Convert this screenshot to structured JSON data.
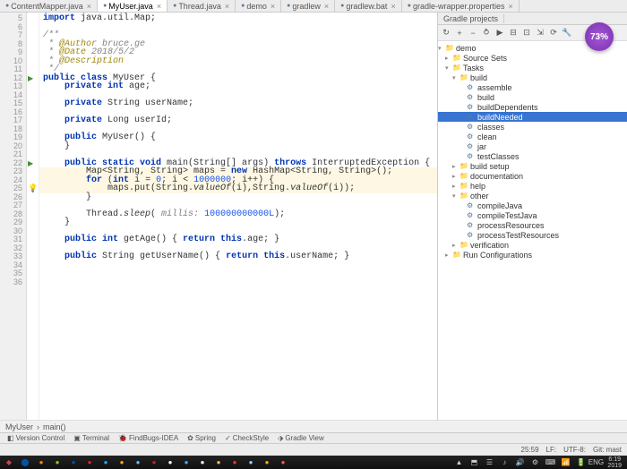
{
  "editor_tabs": [
    {
      "label": "ContentMapper.java",
      "active": false
    },
    {
      "label": "MyUser.java",
      "active": true
    },
    {
      "label": "Thread.java",
      "active": false
    },
    {
      "label": "demo",
      "active": false
    },
    {
      "label": "gradlew",
      "active": false
    },
    {
      "label": "gradlew.bat",
      "active": false
    },
    {
      "label": "gradle-wrapper.properties",
      "active": false
    }
  ],
  "right_tab": "Gradle projects",
  "line_start": 5,
  "line_end": 36,
  "code_lines": [
    {
      "n": 5,
      "html": "<span class='kw'>import</span> java.util.Map;"
    },
    {
      "n": 6,
      "html": ""
    },
    {
      "n": 7,
      "html": "<span class='cm'>/**</span>"
    },
    {
      "n": 8,
      "html": "<span class='cm'> * <span class='ann'>@Author</span> bruce.ge</span>"
    },
    {
      "n": 9,
      "html": "<span class='cm'> * <span class='ann'>@Date</span> 2018/5/2</span>"
    },
    {
      "n": 10,
      "html": "<span class='cm'> * <span class='ann'>@Description</span></span>"
    },
    {
      "n": 11,
      "html": "<span class='cm'> */</span>"
    },
    {
      "n": 12,
      "html": "<span class='kw'>public class</span> MyUser {",
      "run": true
    },
    {
      "n": 13,
      "html": "    <span class='kw'>private int</span> age;"
    },
    {
      "n": 14,
      "html": ""
    },
    {
      "n": 15,
      "html": "    <span class='kw'>private</span> String userName;"
    },
    {
      "n": 16,
      "html": ""
    },
    {
      "n": 17,
      "html": "    <span class='kw'>private</span> Long userId;"
    },
    {
      "n": 18,
      "html": ""
    },
    {
      "n": 19,
      "html": "    <span class='kw'>public</span> MyUser() {"
    },
    {
      "n": 20,
      "html": "    }"
    },
    {
      "n": 21,
      "html": ""
    },
    {
      "n": 22,
      "html": "    <span class='kw'>public static void</span> main(String[] args) <span class='kw'>throws</span> InterruptedException {",
      "run": true
    },
    {
      "n": 23,
      "html": "        Map&lt;String, String&gt; maps = <span class='kw'>new</span> HashMap&lt;String, String&gt;();",
      "hl": true
    },
    {
      "n": 24,
      "html": "        <span class='kw'>for</span> (<span class='kw'>int</span> i = <span class='num'>0</span>; i &lt; <span class='num'>1000000</span>; i++) {",
      "hl": true
    },
    {
      "n": 25,
      "html": "            maps.put(String.<span class='staticm'>valueOf</span>(i),String.<span class='staticm'>valueOf</span>(i));",
      "hl": true,
      "bulb": true
    },
    {
      "n": 26,
      "html": "        }"
    },
    {
      "n": 27,
      "html": ""
    },
    {
      "n": 28,
      "html": "        Thread.<span class='staticm'>sleep</span>( <span class='cm'>millis:</span> <span class='num'>100000000000L</span>);"
    },
    {
      "n": 29,
      "html": "    }"
    },
    {
      "n": 30,
      "html": ""
    },
    {
      "n": 31,
      "html": "    <span class='kw'>public int</span> getAge() { <span class='kw'>return this</span>.age; }"
    },
    {
      "n": 32,
      "html": ""
    },
    {
      "n": 33,
      "html": "    <span class='kw'>public</span> String getUserName() { <span class='kw'>return this</span>.userName; }"
    },
    {
      "n": 34,
      "html": ""
    },
    {
      "n": 35,
      "html": ""
    },
    {
      "n": 36,
      "html": ""
    }
  ],
  "breadcrumb": [
    "MyUser",
    "main()"
  ],
  "gradle_tree": [
    {
      "depth": 0,
      "arrow": "▾",
      "icon": "📁",
      "label": "demo",
      "cls": "ico-folder"
    },
    {
      "depth": 1,
      "arrow": "▸",
      "icon": "📁",
      "label": "Source Sets",
      "cls": "ico-folder"
    },
    {
      "depth": 1,
      "arrow": "▾",
      "icon": "📁",
      "label": "Tasks",
      "cls": "ico-folder"
    },
    {
      "depth": 2,
      "arrow": "▾",
      "icon": "📁",
      "label": "build",
      "cls": "ico-folder"
    },
    {
      "depth": 3,
      "arrow": "",
      "icon": "⚙",
      "label": "assemble",
      "cls": "ico-gear"
    },
    {
      "depth": 3,
      "arrow": "",
      "icon": "⚙",
      "label": "build",
      "cls": "ico-gear"
    },
    {
      "depth": 3,
      "arrow": "",
      "icon": "⚙",
      "label": "buildDependents",
      "cls": "ico-gear"
    },
    {
      "depth": 3,
      "arrow": "",
      "icon": "⚙",
      "label": "buildNeeded",
      "cls": "ico-gear",
      "selected": true
    },
    {
      "depth": 3,
      "arrow": "",
      "icon": "⚙",
      "label": "classes",
      "cls": "ico-gear"
    },
    {
      "depth": 3,
      "arrow": "",
      "icon": "⚙",
      "label": "clean",
      "cls": "ico-gear"
    },
    {
      "depth": 3,
      "arrow": "",
      "icon": "⚙",
      "label": "jar",
      "cls": "ico-gear"
    },
    {
      "depth": 3,
      "arrow": "",
      "icon": "⚙",
      "label": "testClasses",
      "cls": "ico-gear"
    },
    {
      "depth": 2,
      "arrow": "▸",
      "icon": "📁",
      "label": "build setup",
      "cls": "ico-folder"
    },
    {
      "depth": 2,
      "arrow": "▸",
      "icon": "📁",
      "label": "documentation",
      "cls": "ico-folder"
    },
    {
      "depth": 2,
      "arrow": "▸",
      "icon": "📁",
      "label": "help",
      "cls": "ico-folder"
    },
    {
      "depth": 2,
      "arrow": "▾",
      "icon": "📁",
      "label": "other",
      "cls": "ico-folder"
    },
    {
      "depth": 3,
      "arrow": "",
      "icon": "⚙",
      "label": "compileJava",
      "cls": "ico-gear"
    },
    {
      "depth": 3,
      "arrow": "",
      "icon": "⚙",
      "label": "compileTestJava",
      "cls": "ico-gear"
    },
    {
      "depth": 3,
      "arrow": "",
      "icon": "⚙",
      "label": "processResources",
      "cls": "ico-gear"
    },
    {
      "depth": 3,
      "arrow": "",
      "icon": "⚙",
      "label": "processTestResources",
      "cls": "ico-gear"
    },
    {
      "depth": 2,
      "arrow": "▸",
      "icon": "📁",
      "label": "verification",
      "cls": "ico-folder"
    },
    {
      "depth": 1,
      "arrow": "▸",
      "icon": "📁",
      "label": "Run Configurations",
      "cls": "ico-folder"
    }
  ],
  "toolbar_icons": [
    "↻",
    "+",
    "−",
    "⥁",
    "▶",
    "⊟",
    "⊡",
    "⇲",
    "⟳",
    "🔧"
  ],
  "bottom_tools": [
    {
      "icon": "◧",
      "label": "Version Control"
    },
    {
      "icon": "▣",
      "label": "Terminal"
    },
    {
      "icon": "🐞",
      "label": "FindBugs-IDEA"
    },
    {
      "icon": "✿",
      "label": "Spring"
    },
    {
      "icon": "✓",
      "label": "CheckStyle"
    },
    {
      "icon": "⬗",
      "label": "Gradle View"
    }
  ],
  "status": {
    "pos": "25:59",
    "lf": "LF:",
    "enc": "UTF-8:",
    "branch": "Git: mast"
  },
  "badge": "73%",
  "taskbar_left": [
    "◆",
    "⬤",
    "●",
    "●",
    "●",
    "●",
    "●",
    "●",
    "●",
    "●",
    "●",
    "●",
    "●",
    "●",
    "●",
    "●",
    "●",
    "●"
  ],
  "taskbar_colors": [
    "#c44",
    "#05a",
    "#f80",
    "#8c2",
    "#05a",
    "#e22",
    "#2af",
    "#fa0",
    "#6bf",
    "#c22",
    "#fff",
    "#4af",
    "#fff",
    "#fb4",
    "#f33",
    "#9cf",
    "#fa0",
    "#f55"
  ],
  "taskbar_right": [
    "▲",
    "⬒",
    "☰",
    "♪",
    "🔊",
    "⚙",
    "⌨",
    "📶",
    "🔋",
    "ENG"
  ],
  "clock": "6:19\n2019"
}
